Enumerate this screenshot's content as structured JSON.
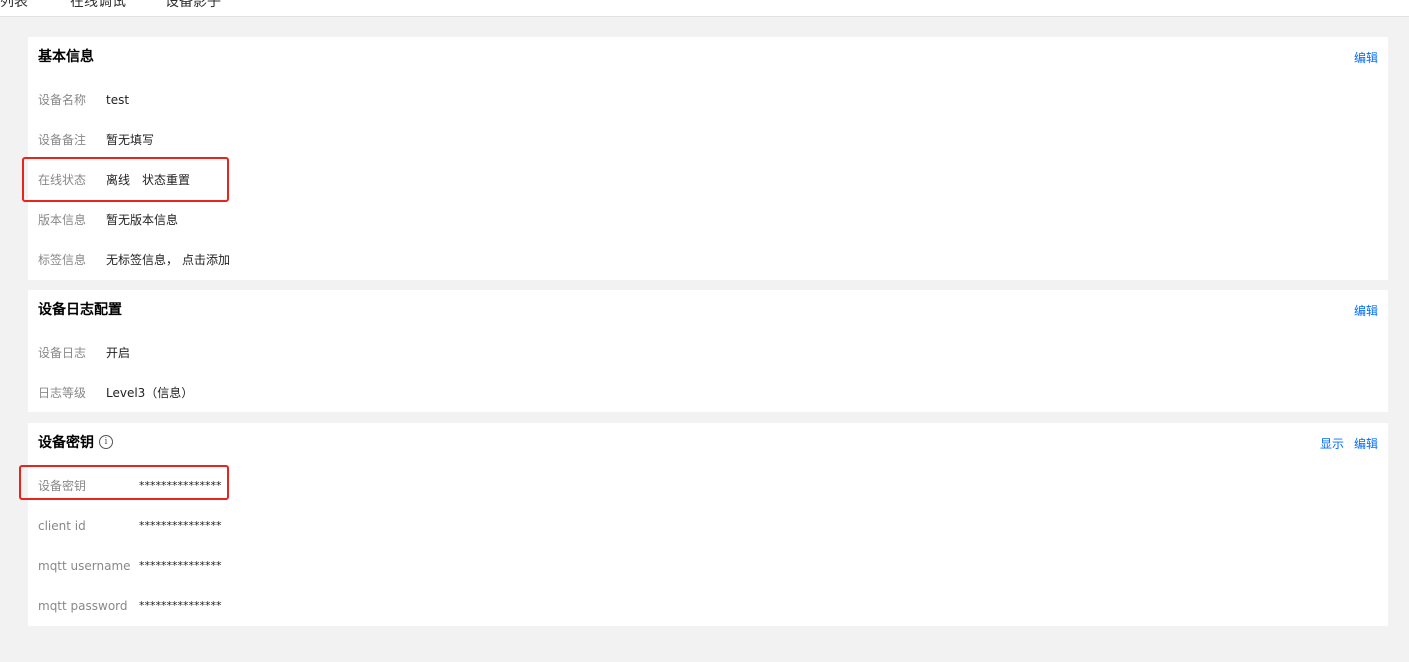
{
  "tabs": [
    "设备列表",
    "在线调试",
    "设备影子"
  ],
  "basic_info": {
    "title": "基本信息",
    "edit_label": "编辑",
    "device_name": {
      "label": "设备名称",
      "value": "test"
    },
    "device_remark": {
      "label": "设备备注",
      "value": "暂无填写"
    },
    "online_status": {
      "label": "在线状态",
      "value": "离线",
      "action": "状态重置"
    },
    "version_info": {
      "label": "版本信息",
      "value": "暂无版本信息"
    },
    "tag_info": {
      "label": "标签信息",
      "value": "无标签信息，",
      "action": "点击添加"
    }
  },
  "log_config": {
    "title": "设备日志配置",
    "edit_label": "编辑",
    "device_log": {
      "label": "设备日志",
      "value": "开启"
    },
    "log_level": {
      "label": "日志等级",
      "value": "Level3（信息）"
    }
  },
  "device_key": {
    "title": "设备密钥",
    "info_icon": "i",
    "show_label": "显示",
    "edit_label": "编辑",
    "rows": [
      {
        "label": "设备密钥",
        "value": "***************"
      },
      {
        "label": "client id",
        "value": "***************"
      },
      {
        "label": "mqtt username",
        "value": "***************"
      },
      {
        "label": "mqtt password",
        "value": "***************"
      }
    ]
  },
  "colors": {
    "accent": "#006eff",
    "offline": "#e54545",
    "highlight": "#e8251d",
    "page_bg": "#f2f2f2"
  }
}
